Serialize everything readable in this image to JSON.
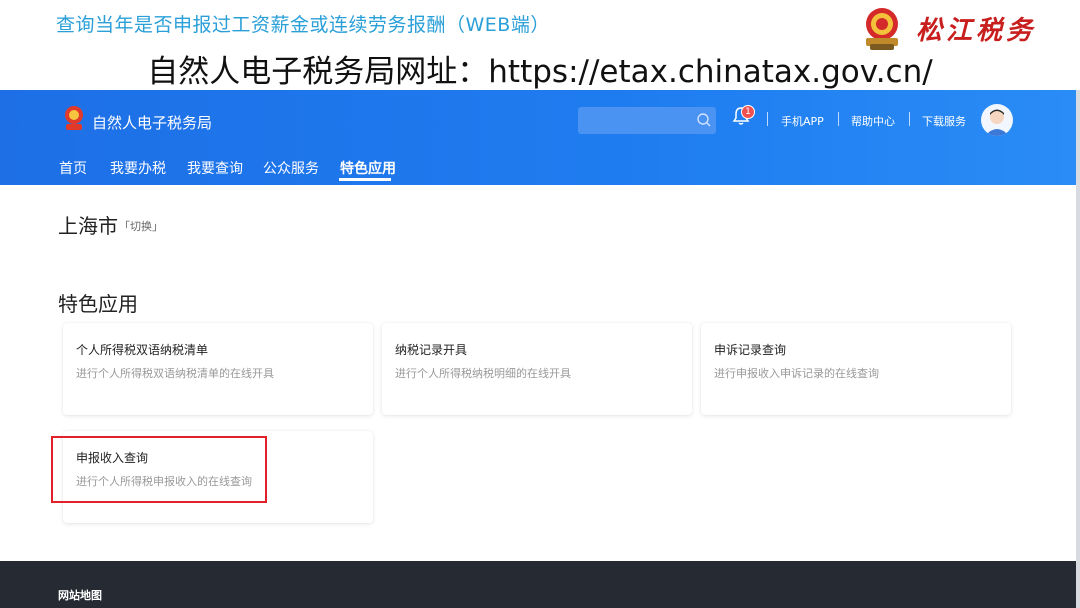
{
  "slide": {
    "title": "查询当年是否申报过工资薪金或连续劳务报酬（WEB端）",
    "url_line": "自然人电子税务局网址：https://etax.chinatax.gov.cn/",
    "brand_text": "松江税务"
  },
  "header": {
    "site_name": "自然人电子税务局",
    "search_placeholder": "",
    "notification_count": "1",
    "links": [
      "手机APP",
      "帮助中心",
      "下载服务"
    ]
  },
  "nav": {
    "items": [
      "首页",
      "我要办税",
      "我要查询",
      "公众服务",
      "特色应用"
    ],
    "active": "特色应用"
  },
  "page": {
    "city": "上海市",
    "switch_label": "「切换」",
    "section_title": "特色应用",
    "cards": [
      {
        "title": "个人所得税双语纳税清单",
        "desc": "进行个人所得税双语纳税清单的在线开具"
      },
      {
        "title": "纳税记录开具",
        "desc": "进行个人所得税纳税明细的在线开具"
      },
      {
        "title": "申诉记录查询",
        "desc": "进行申报收入申诉记录的在线查询"
      },
      {
        "title": "申报收入查询",
        "desc": "进行个人所得税申报收入的在线查询"
      }
    ]
  },
  "footer": {
    "title": "网站地图"
  },
  "colors": {
    "title_blue": "#2a9fd8",
    "header_blue": "#1f7df0",
    "highlight_red": "#e0202a",
    "brand_red": "#c81e1e",
    "footer_dark": "#252a33"
  },
  "icons": [
    "emblem-icon",
    "search-icon",
    "bell-icon",
    "avatar-icon"
  ]
}
